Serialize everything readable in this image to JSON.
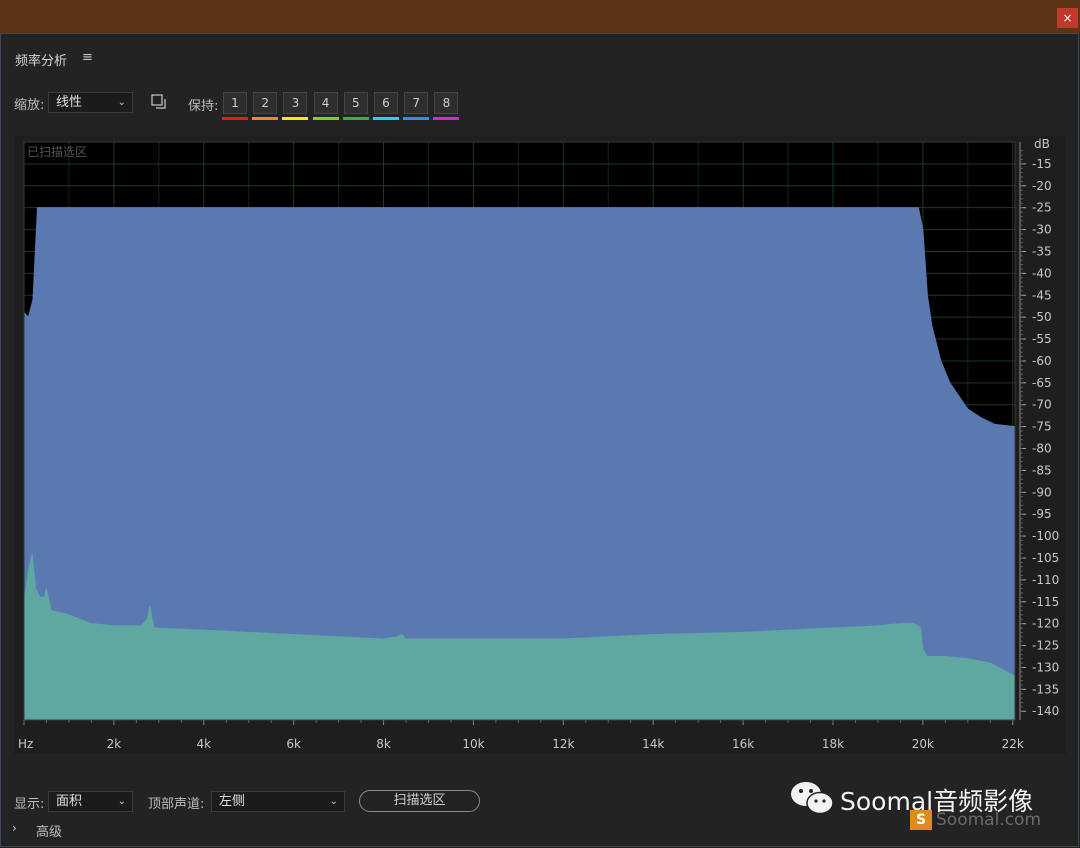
{
  "window": {
    "close_label": "×"
  },
  "panel": {
    "title": "频率分析",
    "menu_icon": "≡"
  },
  "toolbar": {
    "zoom_label": "缩放:",
    "zoom_value": "线性",
    "copy_icon": "copy-icon",
    "hold_label": "保持:",
    "hold_buttons": [
      {
        "label": "1",
        "color": "#e02020"
      },
      {
        "label": "2",
        "color": "#f08a1e"
      },
      {
        "label": "3",
        "color": "#f4e81a"
      },
      {
        "label": "4",
        "color": "#7ed321"
      },
      {
        "label": "5",
        "color": "#34b24a"
      },
      {
        "label": "6",
        "color": "#26d4e8"
      },
      {
        "label": "7",
        "color": "#2e8ff0"
      },
      {
        "label": "8",
        "color": "#e020e0"
      }
    ]
  },
  "graph": {
    "overlay_text": "已扫描选区",
    "db_unit": "dB"
  },
  "chart_data": {
    "type": "area",
    "xlabel": "Hz",
    "x_ticks": [
      "Hz",
      "2k",
      "4k",
      "6k",
      "8k",
      "10k",
      "12k",
      "14k",
      "16k",
      "18k",
      "20k",
      "22k"
    ],
    "x_tick_values": [
      0,
      2000,
      4000,
      6000,
      8000,
      10000,
      12000,
      14000,
      16000,
      18000,
      20000,
      22000
    ],
    "y_ticks": [
      "-15",
      "-20",
      "-25",
      "-30",
      "-35",
      "-40",
      "-45",
      "-50",
      "-55",
      "-60",
      "-65",
      "-70",
      "-75",
      "-80",
      "-85",
      "-90",
      "-95",
      "-100",
      "-105",
      "-110",
      "-115",
      "-120",
      "-125",
      "-130",
      "-135",
      "-140"
    ],
    "xlim": [
      0,
      22050
    ],
    "ylim": [
      -142,
      -10
    ],
    "grid": true,
    "series": [
      {
        "color": "#5b79b1",
        "points": [
          [
            0,
            -49
          ],
          [
            100,
            -50
          ],
          [
            200,
            -46
          ],
          [
            300,
            -25
          ],
          [
            400,
            -25
          ],
          [
            1000,
            -25
          ],
          [
            5000,
            -25
          ],
          [
            10000,
            -25
          ],
          [
            15000,
            -25
          ],
          [
            19500,
            -25
          ],
          [
            19900,
            -25
          ],
          [
            20000,
            -30
          ],
          [
            20100,
            -45
          ],
          [
            20200,
            -52
          ],
          [
            20400,
            -60
          ],
          [
            20600,
            -65
          ],
          [
            20800,
            -68
          ],
          [
            21000,
            -71
          ],
          [
            21300,
            -73
          ],
          [
            21600,
            -74.5
          ],
          [
            22050,
            -75
          ]
        ]
      },
      {
        "color": "#5fa8a2",
        "points": [
          [
            0,
            -115
          ],
          [
            100,
            -108
          ],
          [
            180,
            -104
          ],
          [
            260,
            -112
          ],
          [
            350,
            -114
          ],
          [
            450,
            -114
          ],
          [
            500,
            -112
          ],
          [
            600,
            -117
          ],
          [
            1000,
            -118
          ],
          [
            1500,
            -120
          ],
          [
            2000,
            -120.5
          ],
          [
            2600,
            -120.5
          ],
          [
            2750,
            -119
          ],
          [
            2800,
            -116
          ],
          [
            2850,
            -119
          ],
          [
            2900,
            -121
          ],
          [
            4000,
            -121.5
          ],
          [
            6000,
            -122.5
          ],
          [
            8000,
            -123.5
          ],
          [
            8300,
            -123
          ],
          [
            8400,
            -122.5
          ],
          [
            8500,
            -123.5
          ],
          [
            10000,
            -123.5
          ],
          [
            12000,
            -123.5
          ],
          [
            14000,
            -122.5
          ],
          [
            16000,
            -122
          ],
          [
            18000,
            -121
          ],
          [
            19000,
            -120.5
          ],
          [
            19500,
            -120
          ],
          [
            19800,
            -120
          ],
          [
            19950,
            -121
          ],
          [
            20000,
            -126
          ],
          [
            20100,
            -127.5
          ],
          [
            20500,
            -127.5
          ],
          [
            21000,
            -128
          ],
          [
            21500,
            -129
          ],
          [
            22050,
            -132
          ]
        ]
      }
    ]
  },
  "footer": {
    "display_label": "显示:",
    "display_value": "面积",
    "channel_label": "顶部声道:",
    "channel_value": "左侧",
    "scan_button": "扫描选区",
    "advanced_label": "高级",
    "advanced_chevron": "›"
  },
  "watermark": {
    "title": "Soomal音频影像",
    "sub_icon": "S",
    "sub": "Soomal.com"
  }
}
